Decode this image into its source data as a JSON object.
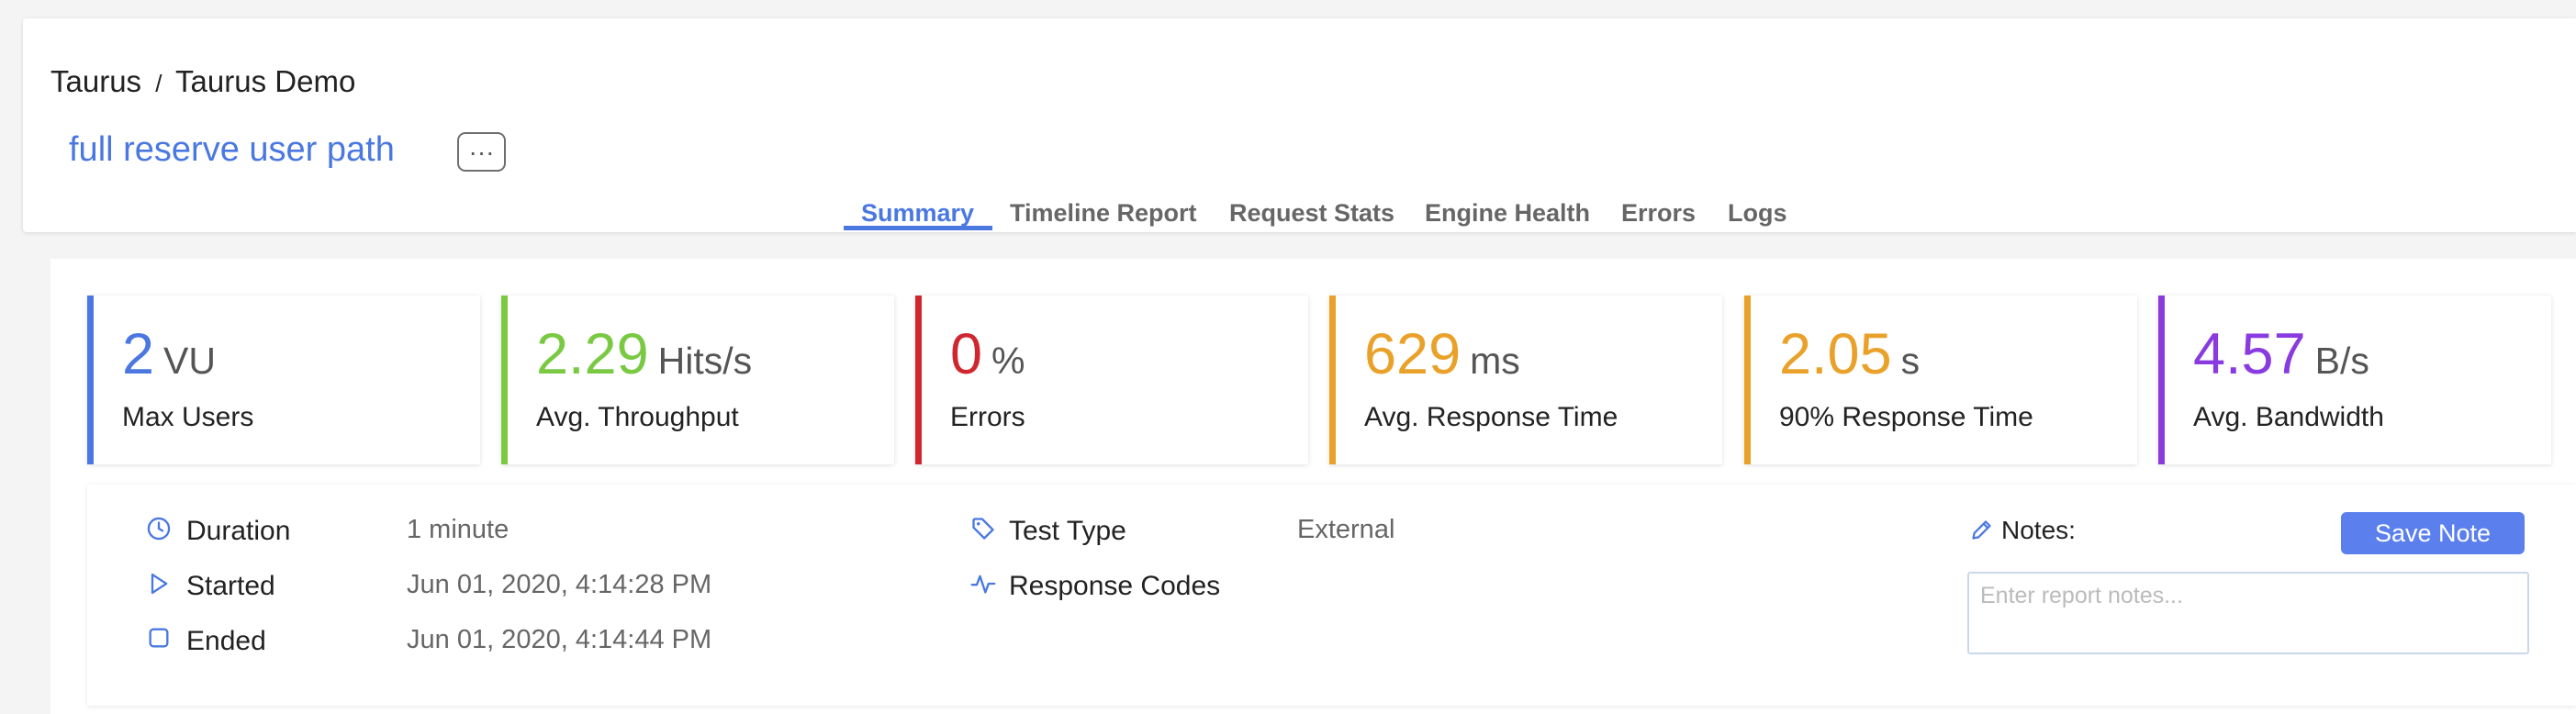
{
  "header": {
    "breadcrumb": {
      "project": "Taurus",
      "separator": "/",
      "test": "Taurus Demo"
    },
    "test_title": "full reserve user path",
    "more_label": "···",
    "tabs": [
      {
        "label": "Summary",
        "active": true
      },
      {
        "label": "Timeline Report"
      },
      {
        "label": "Request Stats"
      },
      {
        "label": "Engine Health"
      },
      {
        "label": "Errors"
      },
      {
        "label": "Logs"
      }
    ]
  },
  "metrics": [
    {
      "value": "2",
      "unit": "VU",
      "label": "Max Users",
      "color": "#4a78e0"
    },
    {
      "value": "2.29",
      "unit": "Hits/s",
      "label": "Avg. Throughput",
      "color": "#7ac943"
    },
    {
      "value": "0",
      "unit": "%",
      "label": "Errors",
      "color": "#d0272f"
    },
    {
      "value": "629",
      "unit": "ms",
      "label": "Avg. Response Time",
      "color": "#e9a12a"
    },
    {
      "value": "2.05",
      "unit": "s",
      "label": "90% Response Time",
      "color": "#e9a12a"
    },
    {
      "value": "4.57",
      "unit": "B/s",
      "label": "Avg. Bandwidth",
      "color": "#8a3be0"
    }
  ],
  "details": {
    "duration": {
      "label": "Duration",
      "value": "1 minute",
      "icon": "clock-icon"
    },
    "started": {
      "label": "Started",
      "value": "Jun 01, 2020, 4:14:28 PM",
      "icon": "play-icon"
    },
    "ended": {
      "label": "Ended",
      "value": "Jun 01, 2020, 4:14:44 PM",
      "icon": "square-icon"
    },
    "test_type": {
      "label": "Test Type",
      "value": "External",
      "icon": "tag-icon"
    },
    "response_codes": {
      "label": "Response Codes",
      "icon": "pulse-icon"
    }
  },
  "notes": {
    "label": "Notes:",
    "icon": "pencil-icon",
    "save_label": "Save Note",
    "placeholder": "Enter report notes...",
    "value": ""
  },
  "colors": {
    "accent": "#4a78e0",
    "save_button": "#5b80ee",
    "icon": "#4a78e0"
  }
}
